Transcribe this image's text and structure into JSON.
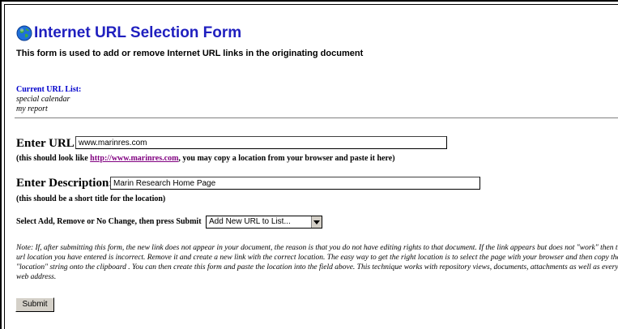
{
  "header": {
    "title": "Internet URL Selection Form",
    "subtitle": "This form is used to add or remove Internet URL links in the originating document"
  },
  "current_list": {
    "label": "Current URL List:",
    "items": [
      "special calendar",
      "my report"
    ]
  },
  "url": {
    "label": "Enter URL:",
    "value": "www.marinres.com",
    "hint_prefix": "(this should look like ",
    "hint_link": "http://www.marinres.com",
    "hint_suffix": ", you may copy a location from your browser and paste it here)"
  },
  "description": {
    "label": "Enter Description:",
    "value": "Marin Research Home Page",
    "hint": "(this should be a short title for the location)"
  },
  "action": {
    "label": "Select Add, Remove or No Change, then press Submit",
    "selected": "Add New URL to List..."
  },
  "note": "Note: If, after submitting this form, the new link does not appear in your document, the reason is that you do not have editing rights to that document. If the link appears but does not \"work\" then the url location you have entered is incorrect. Remove it and create a new link with the correct location. The easy way to get the right location is to select the page with your browser and then copy the \"location\" string onto the clipboard . You can then create this form and paste the location into the field above. This technique works with repository views, documents, attachments as well as every web address.",
  "submit_label": "Submit",
  "icons": {
    "title_icon": "globe-icon"
  },
  "colors": {
    "title": "#1f1fbf",
    "current_label": "#0000cc",
    "link": "#800080"
  }
}
